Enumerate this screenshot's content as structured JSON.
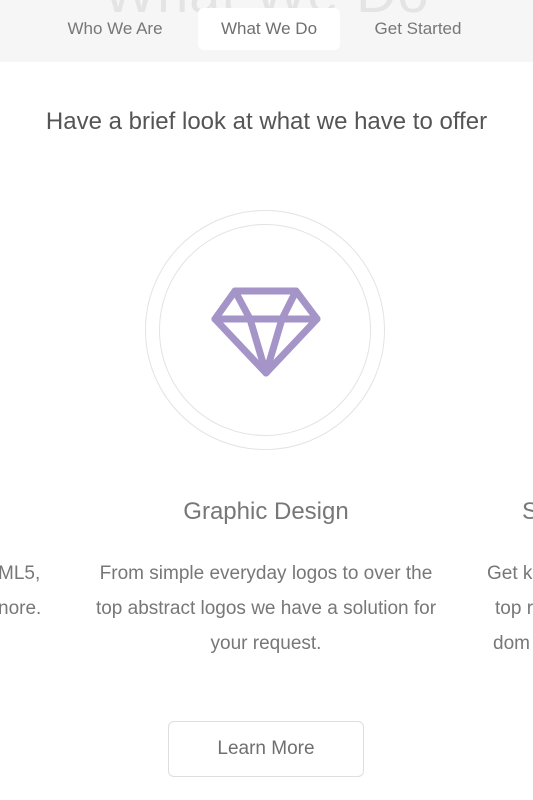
{
  "header": {
    "ghost_title": "What We Do",
    "tabs": [
      {
        "label": "Who We Are",
        "active": false
      },
      {
        "label": "What We Do",
        "active": true
      },
      {
        "label": "Get Started",
        "active": false
      }
    ]
  },
  "main": {
    "subtitle": "Have a brief look at what we have to offer",
    "card": {
      "icon": "diamond-icon",
      "icon_color": "#a594c8",
      "title": "Graphic Design",
      "description": "From simple everyday logos to over the top abstract logos we have a solution for your request.",
      "button_label": "Learn More"
    },
    "left_card_fragment": {
      "lines": [
        "ML5,",
        "nore."
      ]
    },
    "right_card_fragment": {
      "title": "S",
      "lines": [
        "Get k",
        "top r",
        "dom"
      ]
    }
  }
}
